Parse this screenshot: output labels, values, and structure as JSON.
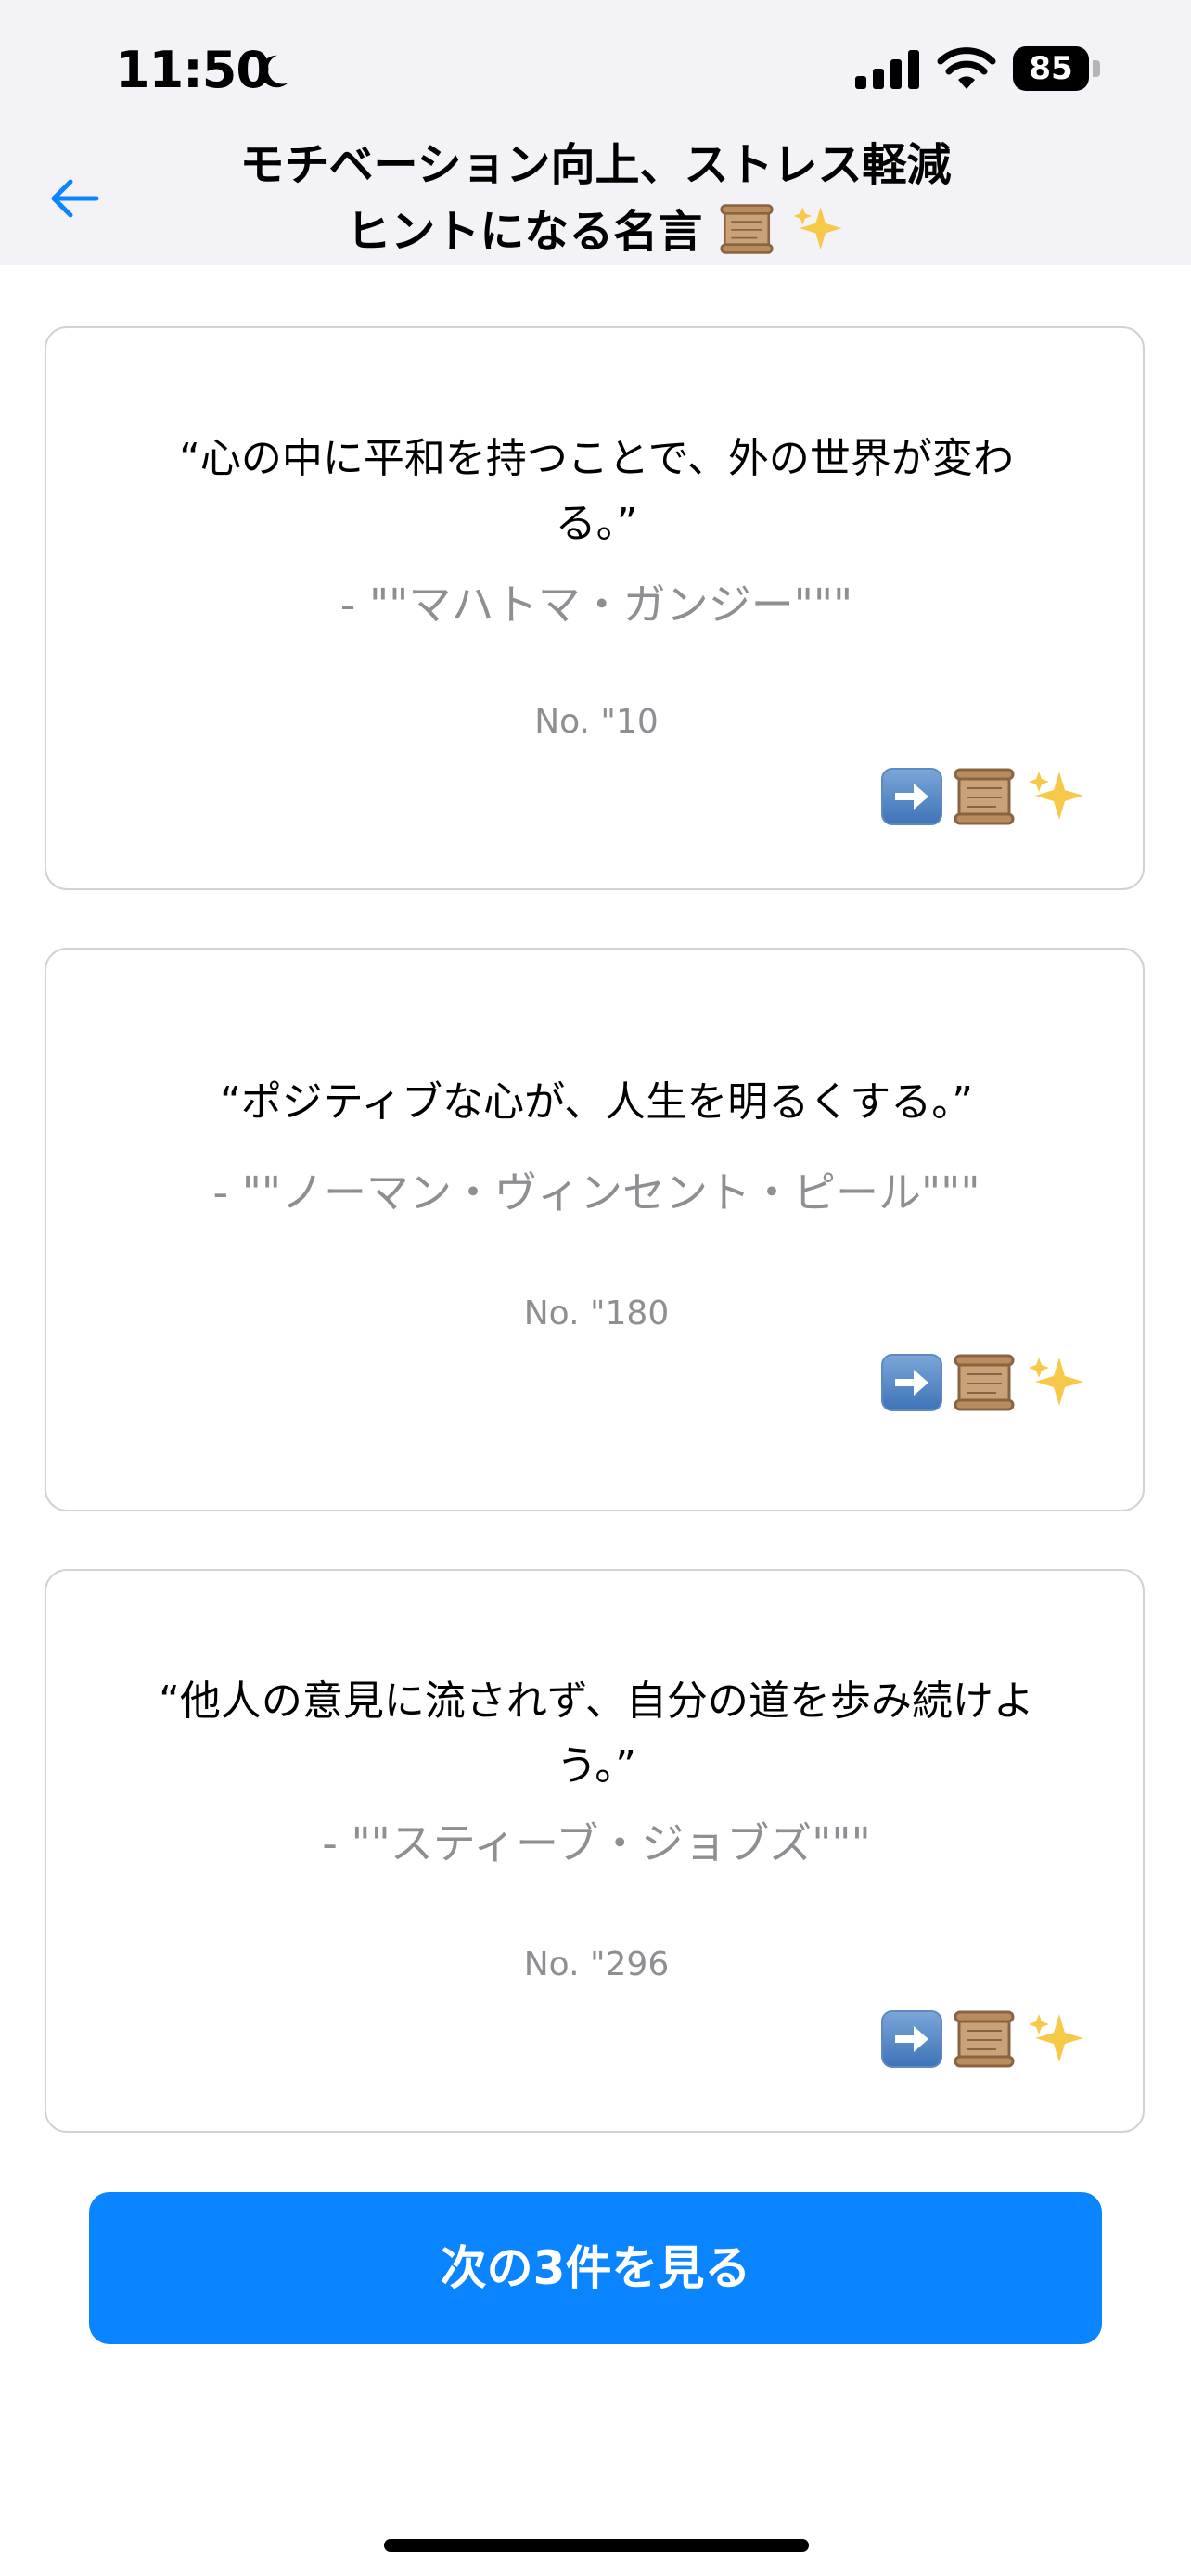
{
  "status_bar": {
    "time": "11:50",
    "battery": "85"
  },
  "nav": {
    "title_line1": "モチベーション向上、ストレス軽減",
    "title_line2": "ヒントになる名言"
  },
  "quotes": [
    {
      "text": "“心の中に平和を持つことで、外の世界が変わる。”",
      "author": "- \"\"マハトマ・ガンジー\"\"\"",
      "number": "No. \"10"
    },
    {
      "text": "“ポジティブな心が、人生を明るくする。”",
      "author": "- \"\"ノーマン・ヴィンセント・ピール\"\"\"",
      "number": "No. \"180"
    },
    {
      "text": "“他人の意見に流されず、自分の道を歩み続けよう。”",
      "author": "- \"\"スティーブ・ジョブズ\"\"\"",
      "number": "No. \"296"
    }
  ],
  "buttons": {
    "next_label": "次の3件を見る"
  },
  "icons": {
    "back": "back-arrow-icon",
    "scroll": "scroll-icon",
    "sparkles": "sparkles-icon",
    "right_arrow": "right-arrow-icon"
  },
  "colors": {
    "accent": "#0a84ff",
    "secondary_text": "#8e8e93",
    "header_bg": "#f2f2f7"
  }
}
